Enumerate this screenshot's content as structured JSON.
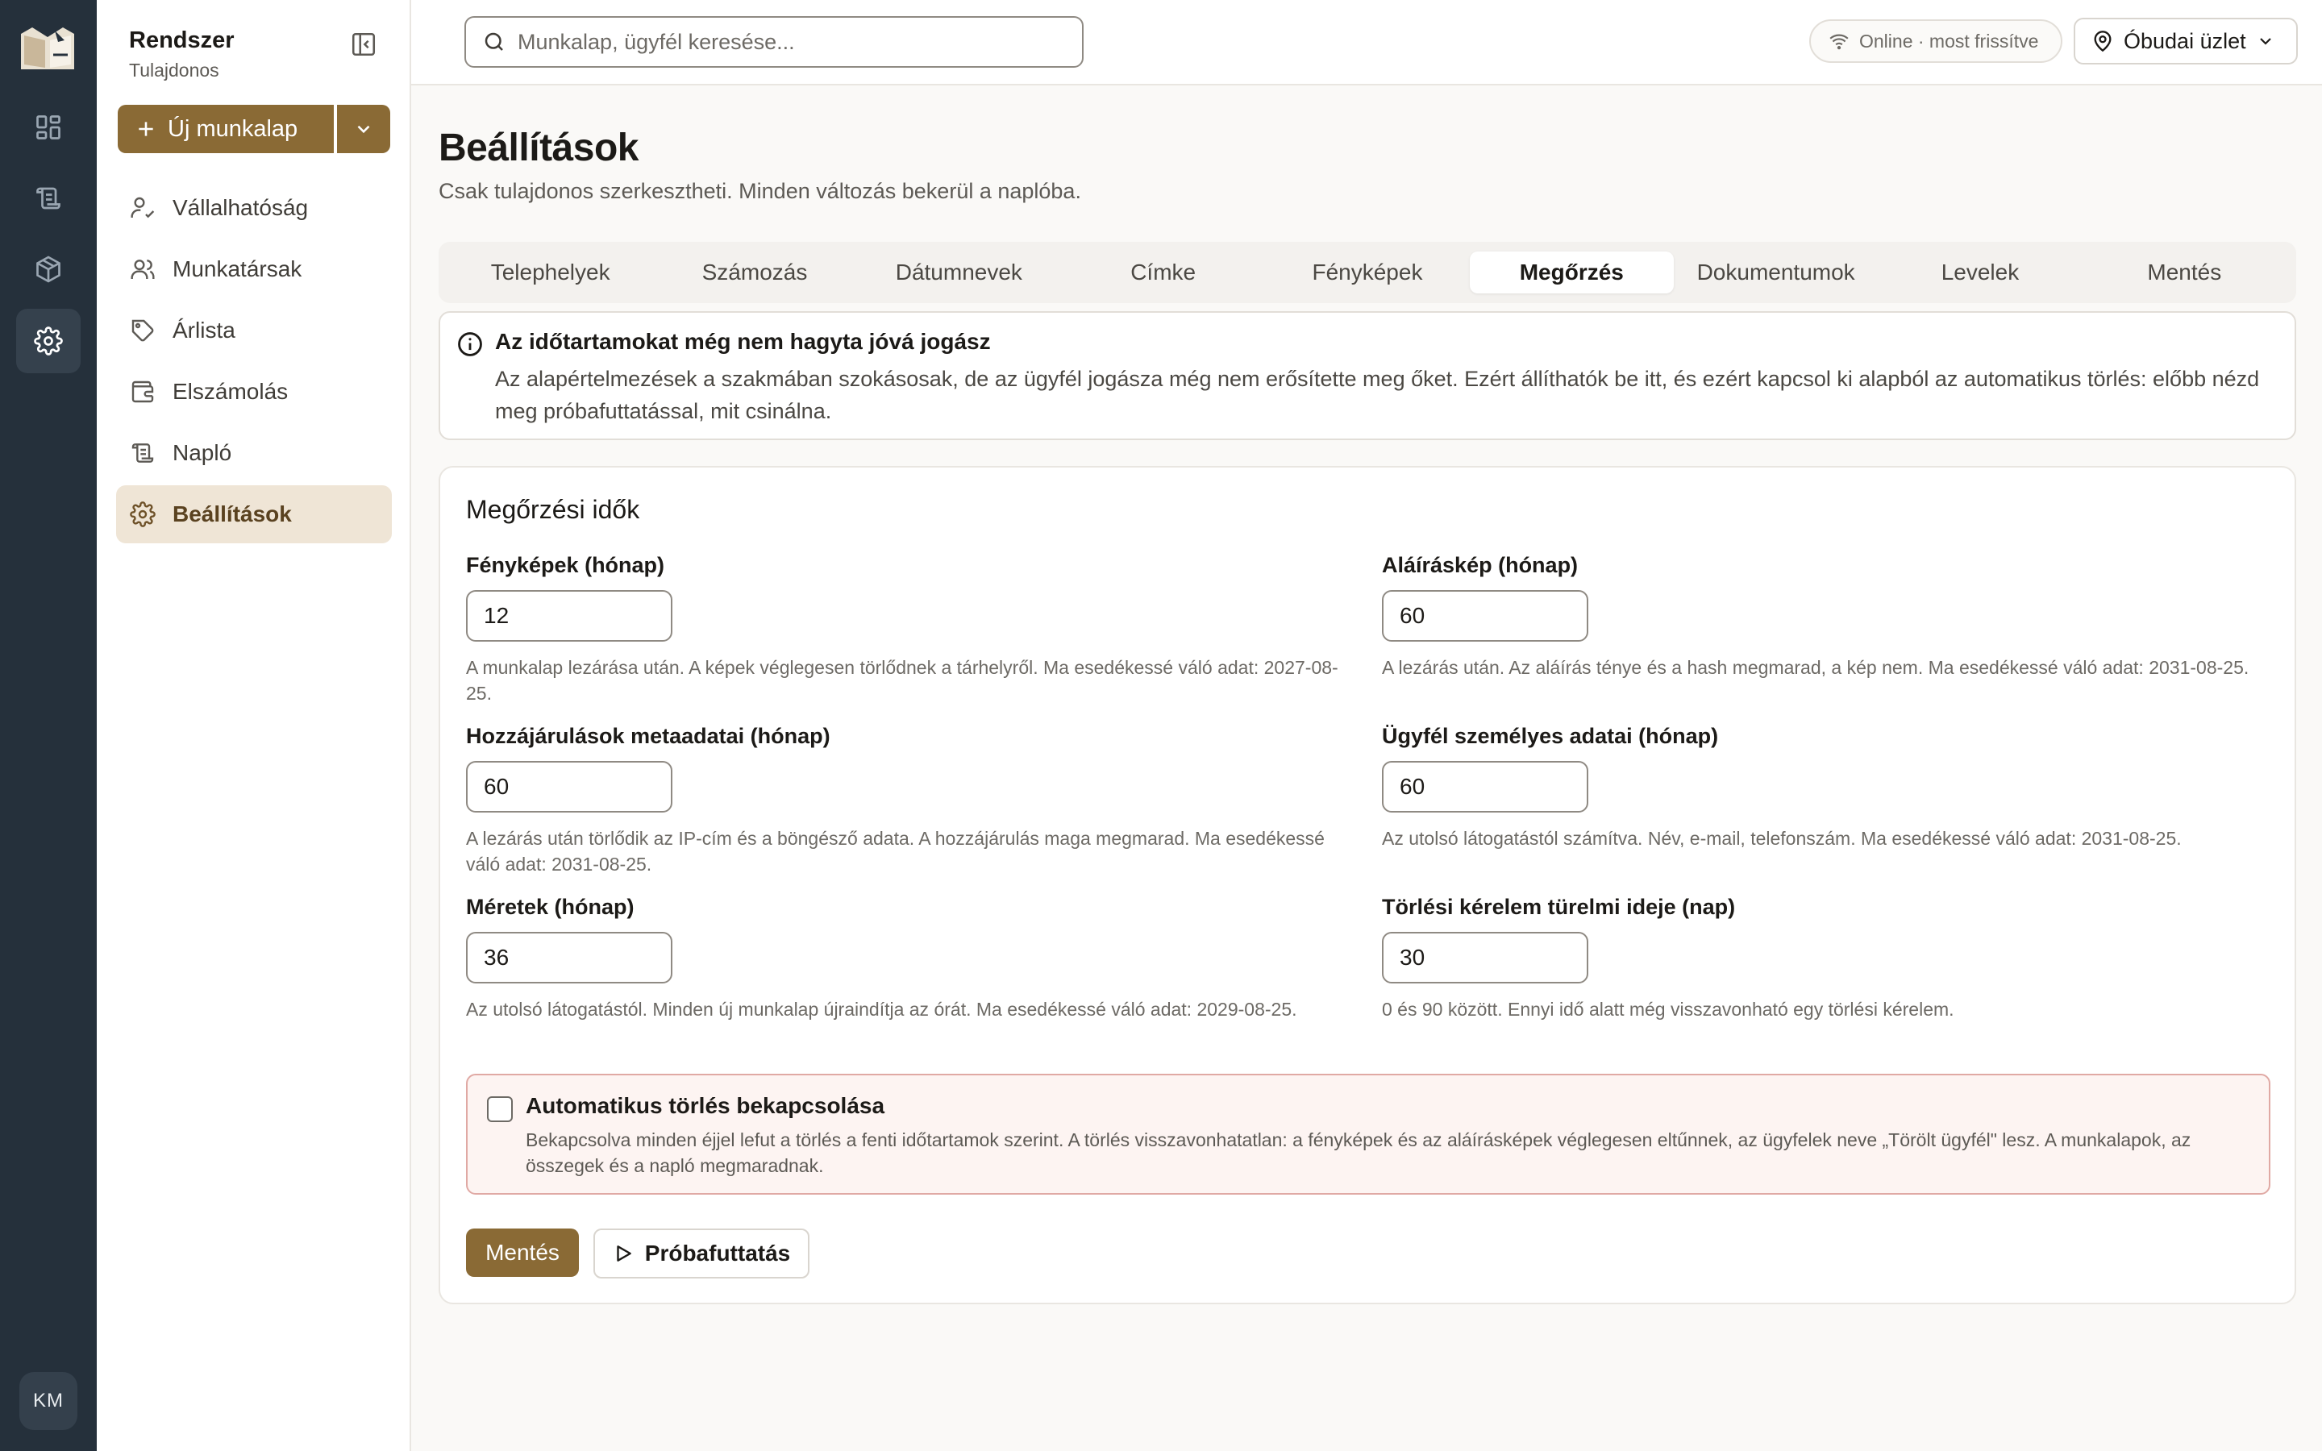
{
  "rail": {
    "avatar_initials": "KM",
    "items": [
      {
        "icon": "dashboard-grid-icon"
      },
      {
        "icon": "ledger-icon"
      },
      {
        "icon": "package-icon"
      },
      {
        "icon": "gear-icon",
        "active": true
      }
    ]
  },
  "sidebar": {
    "org_name": "Rendszer",
    "org_role": "Tulajdonos",
    "new_button": "Új munkalap",
    "items": [
      {
        "label": "Vállalhatóság",
        "icon": "user-check-icon"
      },
      {
        "label": "Munkatársak",
        "icon": "users-icon"
      },
      {
        "label": "Árlista",
        "icon": "price-tag-icon"
      },
      {
        "label": "Elszámolás",
        "icon": "wallet-icon"
      },
      {
        "label": "Napló",
        "icon": "ledger-icon"
      },
      {
        "label": "Beállítások",
        "icon": "gear-icon",
        "active": true
      }
    ]
  },
  "topbar": {
    "search_placeholder": "Munkalap, ügyfél keresése...",
    "status": "Online · most frissítve",
    "store": "Óbudai üzlet"
  },
  "page": {
    "title": "Beállítások",
    "subtitle": "Csak tulajdonos szerkesztheti. Minden változás bekerül a naplóba."
  },
  "tabs": [
    "Telephelyek",
    "Számozás",
    "Dátumnevek",
    "Címke",
    "Fényképek",
    "Megőrzés",
    "Dokumentumok",
    "Levelek",
    "Mentés"
  ],
  "active_tab": "Megőrzés",
  "notice": {
    "title": "Az időtartamokat még nem hagyta jóvá jogász",
    "body": "Az alapértelmezések a szakmában szokásosak, de az ügyfél jogásza még nem erősítette meg őket. Ezért állíthatók be itt, és ezért kapcsol ki alapból az automatikus törlés: előbb nézd meg próbafuttatással, mit csinálna."
  },
  "retention": {
    "title": "Megőrzési idők",
    "fields": {
      "photos": {
        "label": "Fényképek (hónap)",
        "value": "12",
        "help": "A munkalap lezárása után. A képek véglegesen törlődnek a tárhelyről. Ma esedékessé váló adat: 2027-08-25."
      },
      "signature": {
        "label": "Aláíráskép (hónap)",
        "value": "60",
        "help": "A lezárás után. Az aláírás ténye és a hash megmarad, a kép nem. Ma esedékessé váló adat: 2031-08-25."
      },
      "consent": {
        "label": "Hozzájárulások metaadatai (hónap)",
        "value": "60",
        "help": "A lezárás után törlődik az IP-cím és a böngésző adata. A hozzájárulás maga megmarad. Ma esedékessé váló adat: 2031-08-25."
      },
      "personal": {
        "label": "Ügyfél személyes adatai (hónap)",
        "value": "60",
        "help": "Az utolsó látogatástól számítva. Név, e-mail, telefonszám. Ma esedékessé váló adat: 2031-08-25."
      },
      "measurements": {
        "label": "Méretek (hónap)",
        "value": "36",
        "help": "Az utolsó látogatástól. Minden új munkalap újraindítja az órát. Ma esedékessé váló adat: 2029-08-25."
      },
      "grace": {
        "label": "Törlési kérelem türelmi ideje (nap)",
        "value": "30",
        "help": "0 és 90 között. Ennyi idő alatt még visszavonható egy törlési kérelem."
      }
    },
    "autodelete": {
      "label": "Automatikus törlés bekapcsolása",
      "checked": false,
      "body": "Bekapcsolva minden éjjel lefut a törlés a fenti időtartamok szerint. A törlés visszavonhatatlan: a fényképek és az aláírásképek véglegesen eltűnnek, az ügyfelek neve „Törölt ügyfél\" lesz. A munkalapok, az összegek és a napló megmaradnak."
    },
    "save_button": "Mentés",
    "dry_run_button": "Próbafuttatás"
  },
  "colors": {
    "accent": "#8a6a35",
    "rail": "#25303b",
    "active_nav_bg": "#efe5d6",
    "danger_border": "#e0a9a4",
    "danger_bg": "#fdf4f2"
  }
}
